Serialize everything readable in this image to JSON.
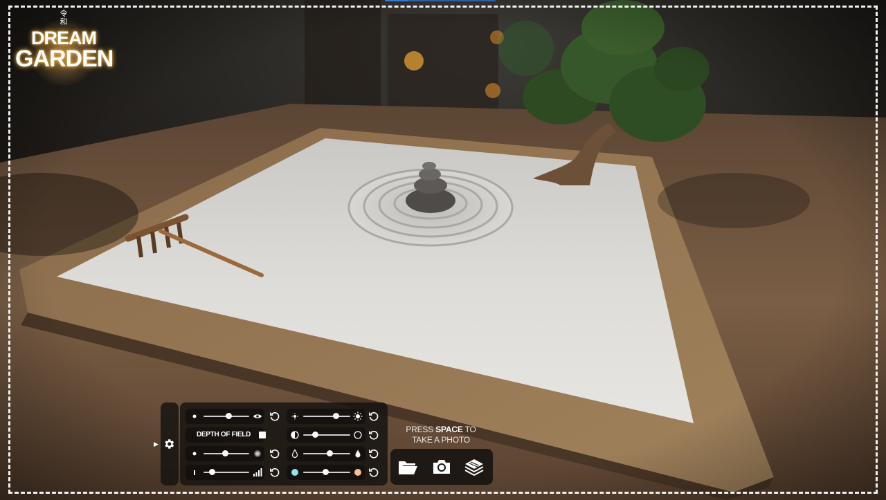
{
  "logo": {
    "kanji_top": "令",
    "kanji_bottom": "和",
    "line1": "DREAM",
    "line2": "GARDEN"
  },
  "controls": {
    "settings_icon": "gear-icon",
    "expand_icon": "play-arrow-icon",
    "left_column": [
      {
        "type": "slider",
        "left_icon": "dot-small-icon",
        "right_icon": "eye-icon",
        "value": 0.48
      },
      {
        "type": "toggle",
        "label": "DEPTH OF FIELD",
        "checked": true
      },
      {
        "type": "slider",
        "left_icon": "dot-small-icon",
        "right_icon": "blur-dot-icon",
        "value": 0.48
      },
      {
        "type": "slider",
        "left_icon": "bar-low-icon",
        "right_icon": "signal-bars-icon",
        "value": 0.18
      }
    ],
    "right_column": [
      {
        "type": "slider",
        "left_icon": "sun-small-icon",
        "right_icon": "sun-large-icon",
        "value": 0.72
      },
      {
        "type": "slider",
        "left_icon": "contrast-icon",
        "right_icon": "circle-outline-icon",
        "value": 0.27
      },
      {
        "type": "slider",
        "left_icon": "droplet-outline-icon",
        "right_icon": "droplet-filled-icon",
        "value": 0.58
      },
      {
        "type": "slider",
        "left_icon": "cool-color-icon",
        "right_icon": "warm-color-icon",
        "value": 0.5,
        "left_color": "#8fe3ee",
        "right_color": "#f6c08f"
      }
    ],
    "reset_icon": "reset-icon"
  },
  "photo": {
    "hint_pre": "PRESS ",
    "hint_key": "SPACE",
    "hint_post": " TO",
    "hint_line2": "TAKE A PHOTO",
    "buttons": [
      "folder-open-icon",
      "camera-icon",
      "layers-icon"
    ]
  }
}
